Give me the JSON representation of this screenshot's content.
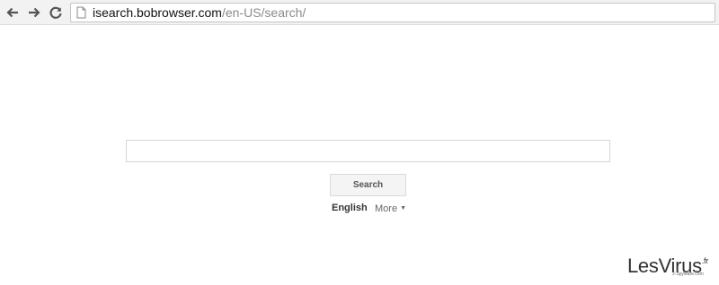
{
  "browser": {
    "url_host": "isearch.bobrowser.com",
    "url_path": "/en-US/search/"
  },
  "search": {
    "input_value": "",
    "button_label": "Search"
  },
  "language": {
    "current": "English",
    "more_label": "More",
    "more_arrow": "▼"
  },
  "watermark": {
    "logo_text": "LesVirus",
    "logo_suffix": ".fr",
    "tagline": "2-Spyware.com"
  },
  "colors": {
    "toolbar_bg": "#f2f2f2",
    "url_host": "#111111",
    "url_path": "#8a8a8a",
    "button_bg": "#f4f4f4"
  },
  "icons": [
    "back-arrow-icon",
    "forward-arrow-icon",
    "reload-icon",
    "page-icon"
  ]
}
